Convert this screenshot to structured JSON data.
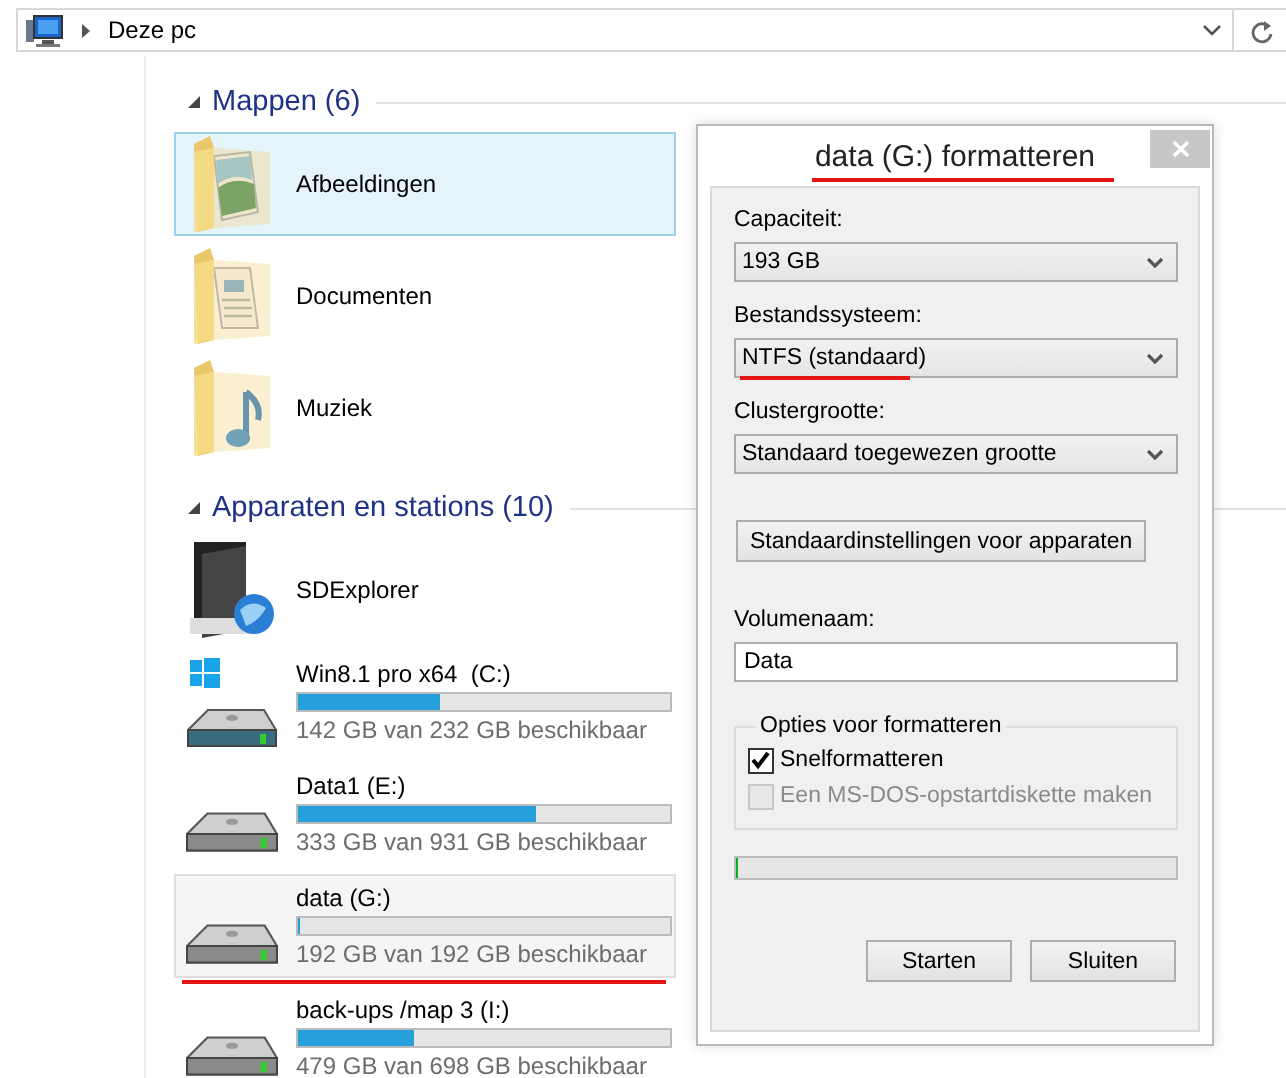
{
  "address_bar": {
    "location": "Deze pc"
  },
  "groups": [
    {
      "title": "Mappen (6)",
      "expanded": true,
      "items": [
        {
          "kind": "pictures",
          "name": "Afbeeldingen",
          "selected": true,
          "hovered": false,
          "marked": false
        },
        {
          "kind": "documents",
          "name": "Documenten",
          "selected": false,
          "hovered": false,
          "marked": false
        },
        {
          "kind": "music",
          "name": "Muziek",
          "selected": false,
          "hovered": false,
          "marked": false
        }
      ]
    },
    {
      "title": "Apparaten en stations (10)",
      "expanded": true,
      "items": [
        {
          "kind": "app",
          "name": "SDExplorer",
          "selected": false,
          "hovered": false,
          "marked": false
        },
        {
          "kind": "systemdrive",
          "name": "Win8.1 pro x64  (C:)",
          "level": 0.38,
          "free": "142 GB van 232 GB beschikbaar",
          "selected": false,
          "hovered": false,
          "marked": false
        },
        {
          "kind": "drive",
          "name": "Data1 (E:)",
          "level": 0.64,
          "free": "333 GB van 931 GB beschikbaar",
          "selected": false,
          "hovered": false,
          "marked": false
        },
        {
          "kind": "drive",
          "name": "data (G:)",
          "level": 0,
          "free": "192 GB van 192 GB beschikbaar",
          "selected": false,
          "hovered": true,
          "marked": true
        },
        {
          "kind": "drive",
          "name": "back-ups /map 3 (I:)",
          "level": 0.31,
          "free": "479 GB van 698 GB beschikbaar",
          "selected": false,
          "hovered": false,
          "marked": false
        }
      ]
    }
  ],
  "dialog": {
    "title": "data (G:) formatteren",
    "title_marked": true,
    "controls": [
      {
        "kind": "dropdown",
        "label": "Capaciteit:",
        "value": "193 GB",
        "marked": false
      },
      {
        "kind": "dropdown",
        "label": "Bestandssysteem:",
        "value": "NTFS (standaard)",
        "marked": true
      },
      {
        "kind": "dropdown",
        "label": "Clustergrootte:",
        "value": "Standaard toegewezen grootte",
        "marked": false
      },
      {
        "kind": "button",
        "text": "Standaardinstellingen voor apparaten"
      },
      {
        "kind": "textbox",
        "label": "Volumenaam:",
        "value": "Data"
      }
    ],
    "options_group": {
      "title": "Opties voor formatteren",
      "options": [
        {
          "label": "Snelformatteren",
          "checked": true,
          "disabled": false
        },
        {
          "label": "Een MS-DOS-opstartdiskette maken",
          "checked": false,
          "disabled": true
        }
      ]
    },
    "progress": {
      "level": 0
    },
    "buttons": [
      "Starten",
      "Sluiten"
    ]
  }
}
